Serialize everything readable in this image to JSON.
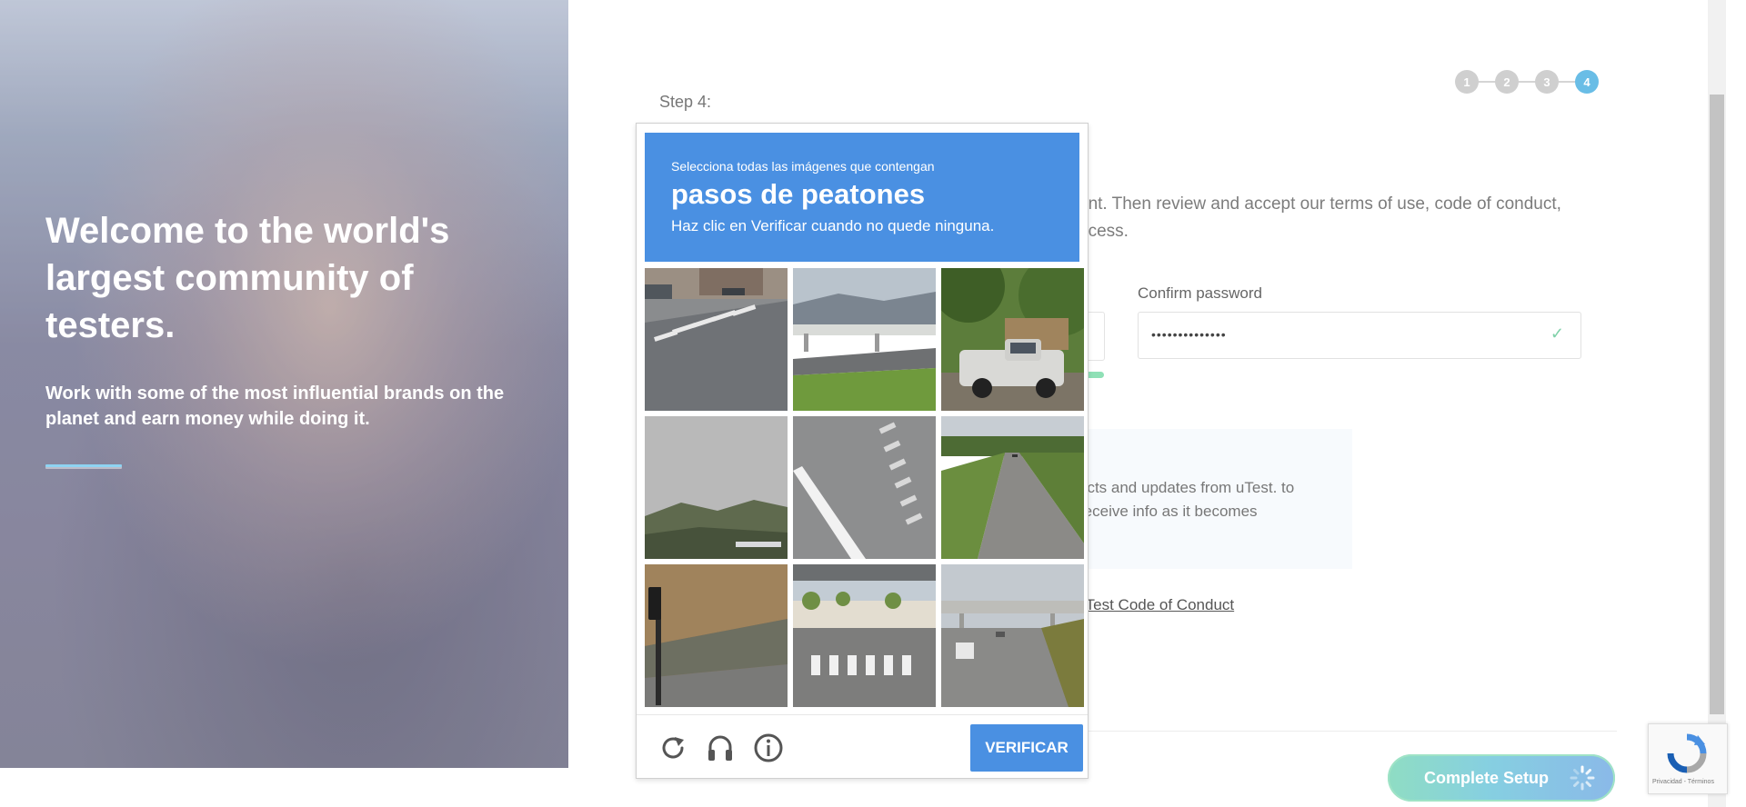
{
  "hero": {
    "title": "Welcome to the world's largest community of testers.",
    "subtitle": "Work with some of the most influential brands on the planet and earn money while doing it."
  },
  "form": {
    "step_label": "Step 4:",
    "steps": [
      "1",
      "2",
      "3",
      "4"
    ],
    "active_step": "4",
    "intro_text": "unt. Then review and accept our terms of use, code of conduct, ocess.",
    "confirm_password_label": "Confirm password",
    "confirm_password_value": "••••••••••••••",
    "notice_text": "ects and updates from uTest. to receive info as it becomes",
    "coc_prefix": "e ",
    "coc_link": "uTest Code of Conduct",
    "complete_button": "Complete Setup"
  },
  "captcha": {
    "instruction": "Selecciona todas las imágenes que contengan",
    "target": "pasos de peatones",
    "hint": "Haz clic en Verificar cuando no quede ninguna.",
    "verify_button": "VERIFICAR",
    "footer_icons": [
      "reload-icon",
      "audio-icon",
      "info-icon"
    ],
    "tiles": [
      {
        "scene": "road with crosswalk"
      },
      {
        "scene": "overpass and grass"
      },
      {
        "scene": "pickup truck under trees"
      },
      {
        "scene": "hills under grey sky"
      },
      {
        "scene": "close-up crosswalk stripes"
      },
      {
        "scene": "highway with trees"
      },
      {
        "scene": "traffic light on hillside"
      },
      {
        "scene": "intersection with crosswalk"
      },
      {
        "scene": "road under overpass"
      }
    ]
  },
  "recaptcha_badge": {
    "links": "Privacidad - Términos"
  },
  "colors": {
    "captcha_blue": "#4a90e2",
    "step_active": "#69bde6",
    "check_green": "#7fd1a9"
  }
}
